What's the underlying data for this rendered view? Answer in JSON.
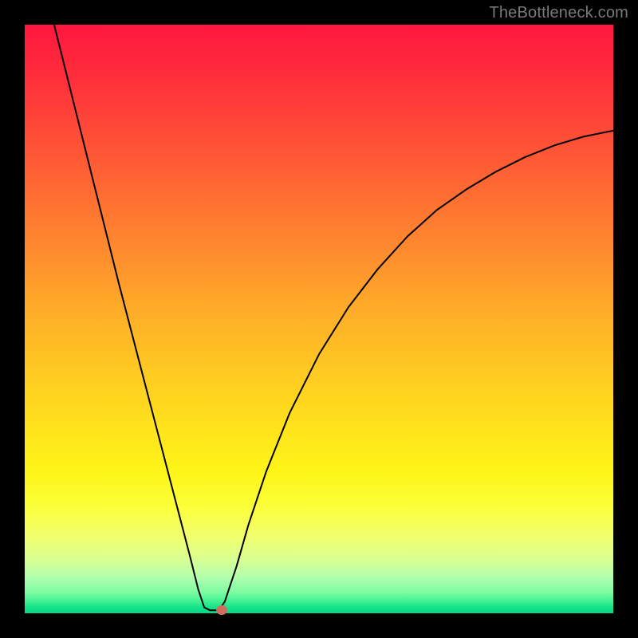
{
  "watermark": "TheBottleneck.com",
  "chart_data": {
    "type": "line",
    "title": "",
    "xlabel": "",
    "ylabel": "",
    "xlim": [
      0,
      100
    ],
    "ylim": [
      0,
      100
    ],
    "grid": false,
    "legend": false,
    "background": "rainbow-gradient-red-to-green-vertical",
    "curve_points": [
      {
        "x": 5.0,
        "y": 100.0
      },
      {
        "x": 7.0,
        "y": 92.0
      },
      {
        "x": 10.0,
        "y": 80.0
      },
      {
        "x": 13.0,
        "y": 68.0
      },
      {
        "x": 16.0,
        "y": 56.0
      },
      {
        "x": 19.0,
        "y": 44.5
      },
      {
        "x": 22.0,
        "y": 33.0
      },
      {
        "x": 25.0,
        "y": 21.5
      },
      {
        "x": 28.0,
        "y": 10.0
      },
      {
        "x": 29.5,
        "y": 4.0
      },
      {
        "x": 30.5,
        "y": 1.0
      },
      {
        "x": 31.5,
        "y": 0.5
      },
      {
        "x": 33.0,
        "y": 0.5
      },
      {
        "x": 34.0,
        "y": 2.0
      },
      {
        "x": 36.0,
        "y": 8.0
      },
      {
        "x": 38.0,
        "y": 15.0
      },
      {
        "x": 41.0,
        "y": 24.0
      },
      {
        "x": 45.0,
        "y": 34.0
      },
      {
        "x": 50.0,
        "y": 44.0
      },
      {
        "x": 55.0,
        "y": 52.0
      },
      {
        "x": 60.0,
        "y": 58.5
      },
      {
        "x": 65.0,
        "y": 64.0
      },
      {
        "x": 70.0,
        "y": 68.5
      },
      {
        "x": 75.0,
        "y": 72.0
      },
      {
        "x": 80.0,
        "y": 75.0
      },
      {
        "x": 85.0,
        "y": 77.5
      },
      {
        "x": 90.0,
        "y": 79.5
      },
      {
        "x": 95.0,
        "y": 81.0
      },
      {
        "x": 100.0,
        "y": 82.0
      }
    ],
    "marker": {
      "x": 33.5,
      "y": 0.5,
      "color": "#cf6d5e"
    }
  }
}
